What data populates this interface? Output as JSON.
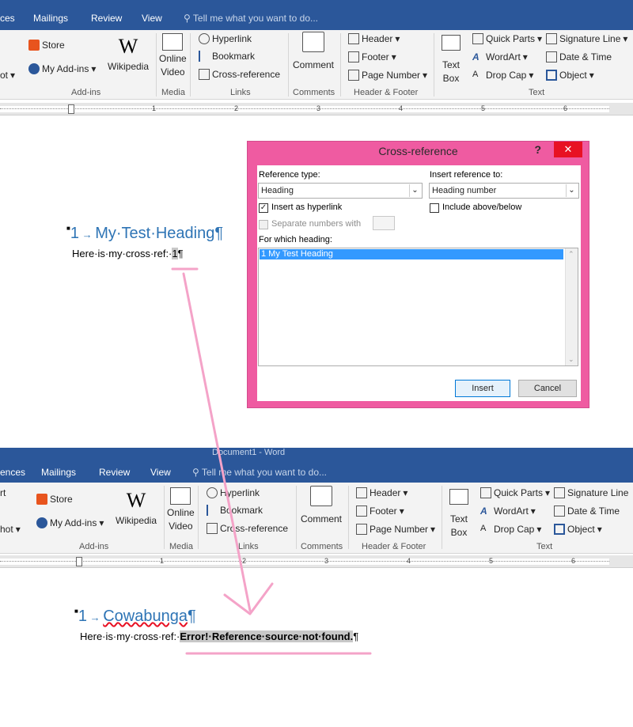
{
  "top": {
    "window_title": "Document1 - Word",
    "tabs": [
      "ces",
      "Mailings",
      "Review",
      "View"
    ],
    "tellme": "Tell me what you want to do...",
    "ribbon": {
      "left_cut": "ot",
      "store": "Store",
      "my_addins": "My Add-ins",
      "wikipedia": "Wikipedia",
      "online_video": [
        "Online",
        "Video"
      ],
      "hyperlink": "Hyperlink",
      "bookmark": "Bookmark",
      "crossref": "Cross-reference",
      "comment": "Comment",
      "header": "Header",
      "footer": "Footer",
      "page_number": "Page Number",
      "text_box": [
        "Text",
        "Box"
      ],
      "quick_parts": "Quick Parts",
      "wordart": "WordArt",
      "drop_cap": "Drop Cap",
      "signature_line": "Signature Line",
      "date_time": "Date & Time",
      "object": "Object",
      "groups": [
        "Add-ins",
        "Media",
        "Links",
        "Comments",
        "Header & Footer",
        "Text"
      ]
    },
    "ruler_numbers": [
      "1",
      "2",
      "3",
      "4",
      "5",
      "6"
    ]
  },
  "doc1": {
    "heading_num": "1",
    "heading_text": "My·Test·Heading",
    "pilcrow": "¶",
    "body_prefix": "Here·is·my·cross·ref:·",
    "field_value": "1",
    "body_pilcrow": "¶"
  },
  "dialog": {
    "title": "Cross-reference",
    "help": "?",
    "close": "✕",
    "reference_type_label": "Reference type:",
    "reference_type_value": "Heading",
    "insert_reference_label": "Insert reference to:",
    "insert_reference_value": "Heading number",
    "insert_hyperlink": "Insert as hyperlink",
    "include_above_below": "Include above/below",
    "separate_numbers": "Separate numbers with",
    "which_heading_label": "For which heading:",
    "list_items": [
      "1 My Test Heading"
    ],
    "insert_button": "Insert",
    "cancel_button": "Cancel"
  },
  "bottom": {
    "window_title": "Document1 - Word",
    "tabs": [
      "ences",
      "Mailings",
      "Review",
      "View"
    ],
    "tellme": "Tell me what you want to do...",
    "ribbon": {
      "left_cut_top": "rt",
      "left_cut": "hot",
      "store": "Store",
      "my_addins": "My Add-ins",
      "wikipedia": "Wikipedia",
      "online_video": [
        "Online",
        "Video"
      ],
      "hyperlink": "Hyperlink",
      "bookmark": "Bookmark",
      "crossref": "Cross-reference",
      "comment": "Comment",
      "header": "Header",
      "footer": "Footer",
      "page_number": "Page Number",
      "text_box": [
        "Text",
        "Box"
      ],
      "quick_parts": "Quick Parts",
      "wordart": "WordArt",
      "drop_cap": "Drop Cap",
      "signature_line": "Signature Line",
      "date_time": "Date & Time",
      "object": "Object",
      "groups": [
        "Add-ins",
        "Media",
        "Links",
        "Comments",
        "Header & Footer",
        "Text"
      ]
    },
    "ruler_numbers": [
      "1",
      "2",
      "3",
      "4",
      "5",
      "6"
    ]
  },
  "doc2": {
    "heading_num": "1",
    "heading_text": "Cowabunga",
    "pilcrow": "¶",
    "body_prefix": "Here·is·my·cross·ref:·",
    "error_text": "Error!·Reference·source·not·found.",
    "body_pilcrow": "¶"
  },
  "colors": {
    "ribbon_blue": "#2b579a",
    "heading_blue": "#2e74b5",
    "dialog_pink": "#ef5ba1",
    "annotation_pink": "#f4a3c8"
  }
}
